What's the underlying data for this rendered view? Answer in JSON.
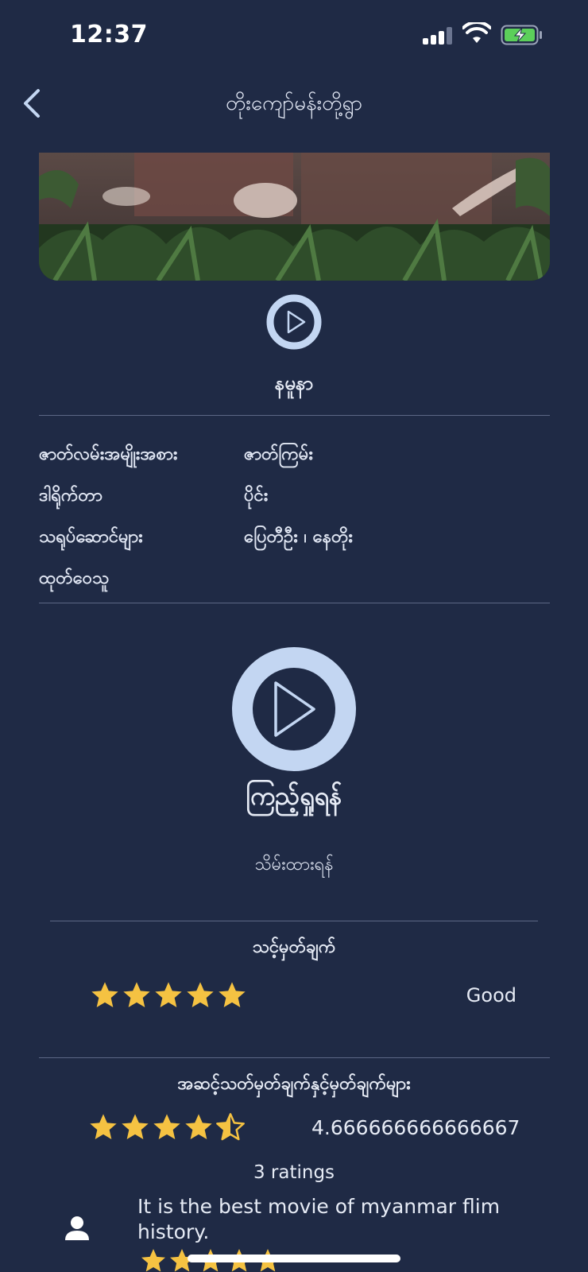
{
  "status_bar": {
    "time": "12:37"
  },
  "header": {
    "title": "တိုးကျော်မန်းတို့ရွာ",
    "back_icon": "chevron-left-icon"
  },
  "movie": {
    "title": "နမူနာ",
    "details": [
      {
        "label": "ဇာတ်လမ်းအမျိုးအစား",
        "value": "ဇာတ်ကြမ်း"
      },
      {
        "label": "ဒါရိုက်တာ",
        "value": "ပိုင်း"
      },
      {
        "label": "သရုပ်ဆောင်များ",
        "value": "ပြေတီဦး ၊ နေတိုး"
      },
      {
        "label": "ထုတ်ဝေသူ",
        "value": ""
      }
    ]
  },
  "actions": {
    "watch_label": "ကြည့်ရှုရန်",
    "save_label": "သိမ်းထားရန်"
  },
  "your_rating": {
    "title": "သင့်မှတ်ချက်",
    "stars": 5,
    "label": "Good"
  },
  "community_rating": {
    "title": "အဆင့်သတ်မှတ်ချက်နှင့်မှတ်ချက်များ",
    "stars": 4.5,
    "average": "4.666666666666667",
    "count_text": "3 ratings"
  },
  "reviews": [
    {
      "text": "It is the best movie of myanmar flim history.",
      "stars": 5
    }
  ],
  "colors": {
    "background": "#1f2a45",
    "accent": "#c3d6f2",
    "star": "#f5c242",
    "divider": "#5c6785"
  }
}
